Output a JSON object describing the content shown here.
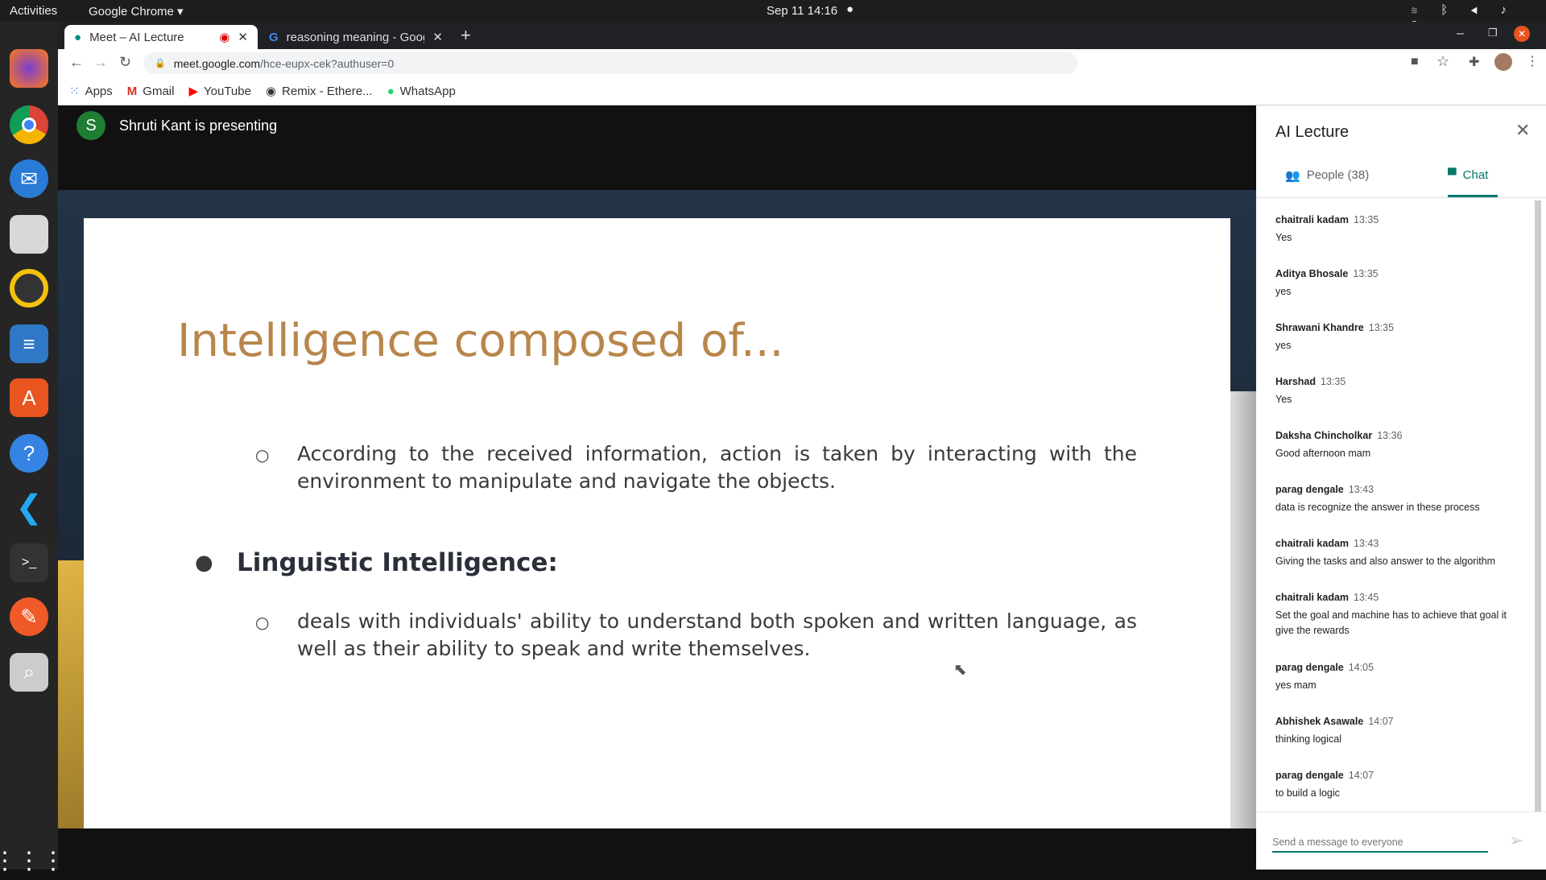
{
  "system": {
    "activities": "Activities",
    "app": "Google Chrome",
    "datetime": "Sep 11  14:16"
  },
  "tabs": [
    {
      "title": "Meet – AI Lecture"
    },
    {
      "title": "reasoning meaning - Goog"
    }
  ],
  "address": {
    "domain": "meet.google.com",
    "path": "/hce-eupx-cek?authuser=0"
  },
  "bookmarks": [
    "Apps",
    "Gmail",
    "YouTube",
    "Remix - Ethere...",
    "WhatsApp"
  ],
  "presenter": {
    "initial": "S",
    "text": "Shruti Kant is presenting"
  },
  "slide": {
    "title": "Intelligence composed of...",
    "sub1": "According to the received information, action is taken by interacting with the environment to manipulate and navigate the objects.",
    "heading": "Linguistic Intelligence:",
    "sub2": "deals with individuals' ability to understand both spoken and written language, as well as their ability to speak and write themselves."
  },
  "panel": {
    "title": "AI Lecture",
    "people_tab": "People (38)",
    "chat_tab": "Chat",
    "input_placeholder": "Send a message to everyone",
    "messages": [
      {
        "name": "chaitrali kadam",
        "time": "13:35",
        "text": "Yes"
      },
      {
        "name": "Aditya Bhosale",
        "time": "13:35",
        "text": "yes"
      },
      {
        "name": "Shrawani Khandre",
        "time": "13:35",
        "text": "yes"
      },
      {
        "name": "Harshad",
        "time": "13:35",
        "text": "Yes"
      },
      {
        "name": "Daksha Chincholkar",
        "time": "13:36",
        "text": "Good afternoon mam"
      },
      {
        "name": "parag dengale",
        "time": "13:43",
        "text": "data is recognize the answer in these process"
      },
      {
        "name": "chaitrali kadam",
        "time": "13:43",
        "text": "Giving the tasks and also answer to the algorithm"
      },
      {
        "name": "chaitrali kadam",
        "time": "13:45",
        "text": "Set the goal and machine has to achieve that goal it give the rewards"
      },
      {
        "name": "parag dengale",
        "time": "14:05",
        "text": "yes mam"
      },
      {
        "name": "Abhishek Asawale",
        "time": "14:07",
        "text": "thinking logical"
      },
      {
        "name": "parag dengale",
        "time": "14:07",
        "text": "to build a logic"
      }
    ]
  },
  "colors": {
    "accent": "#00796b",
    "title": "#b8864b"
  }
}
